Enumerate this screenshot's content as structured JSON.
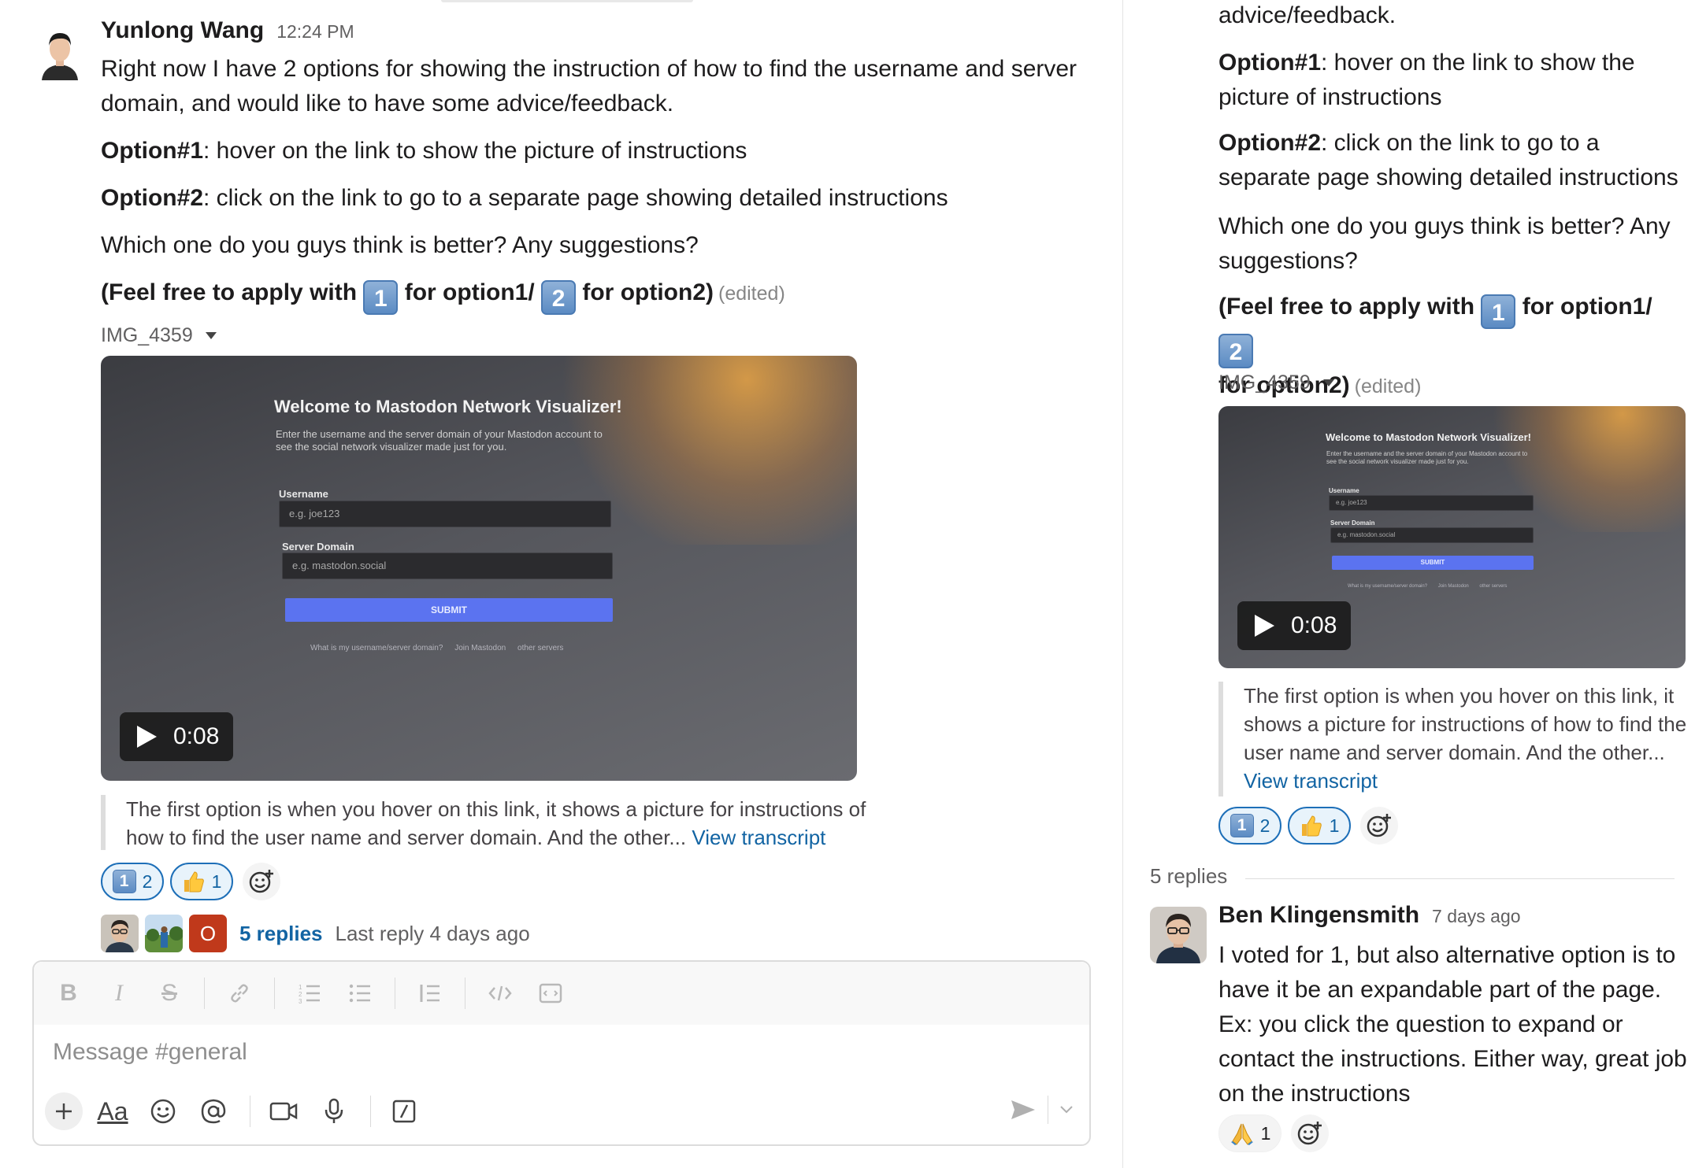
{
  "main_message": {
    "sender": "Yunlong Wang",
    "time": "12:24 PM",
    "intro": "Right now I have 2 options for showing the instruction of how to find the username and server domain, and would like to have some advice/feedback.",
    "option1_label": "Option#1",
    "option1_text": ": hover on the link to show the picture of instructions",
    "option2_label": "Option#2",
    "option2_text": ": click on the link to go to a separate page showing detailed instructions",
    "question": "Which one do you guys think is better? Any suggestions?",
    "apply_prefix": "(Feel free to apply with ",
    "emoji_1": "1",
    "apply_mid": " for option1/ ",
    "emoji_2": "2",
    "apply_suffix": " for option2)",
    "edited": "(edited)",
    "file_name": "IMG_4359",
    "video": {
      "duration": "0:08",
      "screen_title": "Welcome to Mastodon Network Visualizer!",
      "screen_desc": "Enter the username and the server domain of your Mastodon account to see the social network visualizer made just for you.",
      "username_label": "Username",
      "username_placeholder": "e.g. joe123",
      "domain_label": "Server Domain",
      "domain_placeholder": "e.g. mastodon.social",
      "submit_label": "SUBMIT",
      "link_1": "What is my username/server domain?",
      "link_2": "Join Mastodon",
      "link_3": "other servers"
    },
    "transcript": "The first option is when you hover on this link, it shows a picture for instructions of how to find the user name and server domain. And the other...",
    "transcript_rp": "The first option is when you hover on this link, it shows a picture for instructions of how to find the user name and server domain. And the other...",
    "view_transcript": "View transcript",
    "reactions": [
      {
        "emoji": "keycap-1",
        "count": "2",
        "mine": true
      },
      {
        "emoji": "thumbs-up",
        "count": "1",
        "mine": true
      }
    ],
    "thread_summary": {
      "replies_label": "5 replies",
      "last_reply": "Last reply 4 days ago",
      "third_avatar_letter": "O"
    }
  },
  "composer": {
    "placeholder": "Message #general",
    "aa_label": "Aa"
  },
  "thread_panel": {
    "top_partial": "advice/feedback.",
    "option1_rest": ": hover on the link to show the picture of instructions",
    "option2_rest": ": click on the link to go to a separate page showing detailed instructions",
    "question": "Which one do you guys think is better? Any suggestions?",
    "apply_last": "for option2)",
    "replies_count_label": "5 replies",
    "reply": {
      "sender": "Ben Klingensmith",
      "time": "7 days ago",
      "text": "I voted for 1, but also alternative option is to have it be an expandable part of the page. Ex: you click the question to expand or contact the instructions. Either way, great job on the instructions",
      "reaction_count": "1",
      "reaction_emoji": "folded-hands"
    }
  },
  "colors": {
    "link": "#1264a3",
    "reaction_border": "#1d6fb8",
    "reaction_bg": "#e8f3fb",
    "keycap": "#6a97cc",
    "submit_button": "#5b73f0",
    "avatar_o": "#c0391b"
  }
}
